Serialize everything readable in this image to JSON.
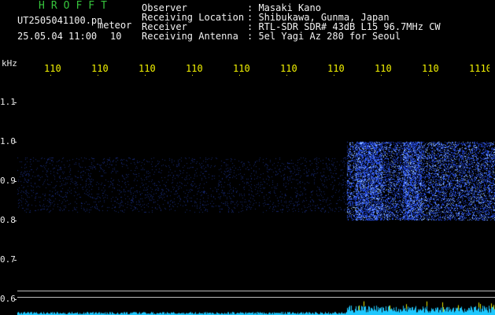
{
  "header": {
    "app_title": "HROFFT",
    "file_name": "UT2505041100.pn",
    "file_type": "meteor",
    "datetime": "25.05.04 11:00",
    "count": "10"
  },
  "metadata": [
    {
      "key": "Observer",
      "value": ": Masaki Kano"
    },
    {
      "key": "Receiving Location",
      "value": ": Shibukawa, Gunma, Japan"
    },
    {
      "key": "Receiver",
      "value": ": RTL-SDR SDR# 43dB L15 96.7MHz CW"
    },
    {
      "key": "Receiving Antenna",
      "value": ": 5el Yagi Az 280 for Seoul"
    }
  ],
  "axis": {
    "y_unit": "kHz",
    "x_ticks": [
      "110",
      "110",
      "110",
      "110",
      "110",
      "110",
      "110",
      "110",
      "110",
      "1110"
    ],
    "y_ticks": [
      "1.1",
      "1.0",
      "0.9",
      "0.8",
      "0.7",
      "0.6"
    ]
  },
  "colors": {
    "background": "#000000",
    "signal": "#2a55ff",
    "signal_bright": "#7fb2ff",
    "tick_label": "#f2f200",
    "title": "#36c43c",
    "level": "#1ec8ff"
  },
  "spectrogram": {
    "weak_band_khz": [
      0.82,
      0.96
    ],
    "strong_band_khz": [
      0.8,
      1.0
    ],
    "strong_start_fraction": 0.69
  }
}
